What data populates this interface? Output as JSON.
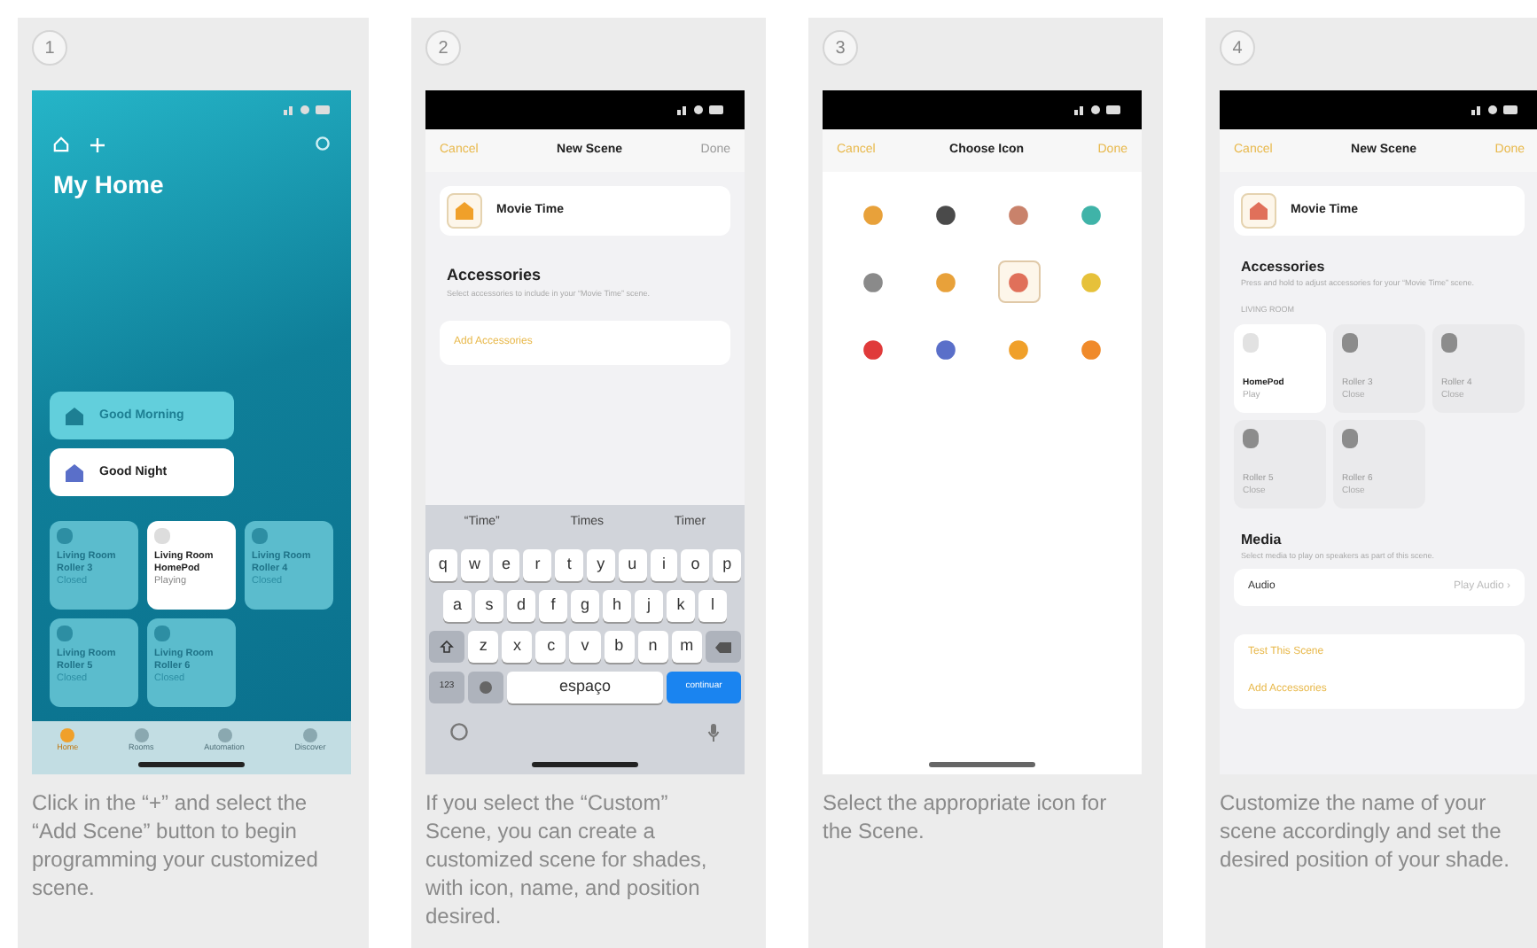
{
  "steps": [
    {
      "number": "1",
      "kind": "home",
      "caption": "Click in the “+” and select the “Add Scene” button to begin programming your customized scene.",
      "title": "My Home",
      "scenes": [
        {
          "label": "Good Morning",
          "on": false
        },
        {
          "label": "Good Night",
          "on": true
        }
      ],
      "accessories": [
        {
          "name": "Living Room Roller 3",
          "status": "Closed",
          "on": false
        },
        {
          "name": "Living Room HomePod",
          "status": "Playing",
          "on": true
        },
        {
          "name": "Living Room Roller 4",
          "status": "Closed",
          "on": false
        },
        {
          "name": "Living Room Roller 5",
          "status": "Closed",
          "on": false
        },
        {
          "name": "Living Room Roller 6",
          "status": "Closed",
          "on": false
        }
      ],
      "tabs": [
        {
          "label": "Home",
          "selected": true
        },
        {
          "label": "Rooms",
          "selected": false
        },
        {
          "label": "Automation",
          "selected": false
        },
        {
          "label": "Discover",
          "selected": false
        }
      ]
    },
    {
      "number": "2",
      "kind": "new_scene",
      "caption": "If you select the “Custom” Scene, you can create a customized scene for shades, with icon, name, and position desired.",
      "nav": {
        "cancel": "Cancel",
        "title": "New Scene",
        "done": "Done",
        "done_disabled": true
      },
      "scene_name": "Movie Time",
      "accessories_title": "Accessories",
      "accessories_hint": "Select accessories to include in your “Movie Time” scene.",
      "add_button": "Add Accessories",
      "suggestions": [
        "“Time”",
        "Times",
        "Timer"
      ],
      "key_rows": [
        [
          "q",
          "w",
          "e",
          "r",
          "t",
          "y",
          "u",
          "i",
          "o",
          "p"
        ],
        [
          "a",
          "s",
          "d",
          "f",
          "g",
          "h",
          "j",
          "k",
          "l"
        ],
        [
          "z",
          "x",
          "c",
          "v",
          "b",
          "n",
          "m"
        ]
      ],
      "numbers_key": "123",
      "space_key": "espaço",
      "return_key": "continuar"
    },
    {
      "number": "3",
      "kind": "choose_icon",
      "caption": "Select the appropriate icon for the Scene.",
      "nav": {
        "cancel": "Cancel",
        "title": "Choose Icon",
        "done": "Done",
        "done_disabled": false
      },
      "icons": [
        {
          "color": "#e8a13a",
          "selected": false
        },
        {
          "color": "#4a4a4a",
          "selected": false
        },
        {
          "color": "#c9826b",
          "selected": false
        },
        {
          "color": "#3fb3a8",
          "selected": false
        },
        {
          "color": "#8a8a8a",
          "selected": false
        },
        {
          "color": "#e8a13a",
          "selected": false
        },
        {
          "color": "#e0705a",
          "selected": true
        },
        {
          "color": "#e6c13a",
          "selected": false
        },
        {
          "color": "#e03a3a",
          "selected": false
        },
        {
          "color": "#5a6fc9",
          "selected": false
        },
        {
          "color": "#f0a02a",
          "selected": false
        },
        {
          "color": "#f08a2a",
          "selected": false
        }
      ]
    },
    {
      "number": "4",
      "kind": "scene_detail",
      "caption": "Customize the name of your scene accordingly and set the desired position of your shade.",
      "nav": {
        "cancel": "Cancel",
        "title": "New Scene",
        "done": "Done",
        "done_disabled": false
      },
      "scene_name": "Movie Time",
      "accessories_title": "Accessories",
      "accessories_hint": "Press and hold to adjust accessories for your “Movie Time” scene.",
      "room": "LIVING ROOM",
      "tiles": [
        {
          "name": "HomePod",
          "status": "Play",
          "on": true
        },
        {
          "name": "Roller 3",
          "status": "Close",
          "on": false
        },
        {
          "name": "Roller 4",
          "status": "Close",
          "on": false
        },
        {
          "name": "Roller 5",
          "status": "Close",
          "on": false
        },
        {
          "name": "Roller 6",
          "status": "Close",
          "on": false
        }
      ],
      "media_title": "Media",
      "media_hint": "Select media to play on speakers as part of this scene.",
      "audio_label": "Audio",
      "audio_value": "Play Audio ›",
      "actions": [
        "Test This Scene",
        "Add Accessories"
      ]
    }
  ]
}
